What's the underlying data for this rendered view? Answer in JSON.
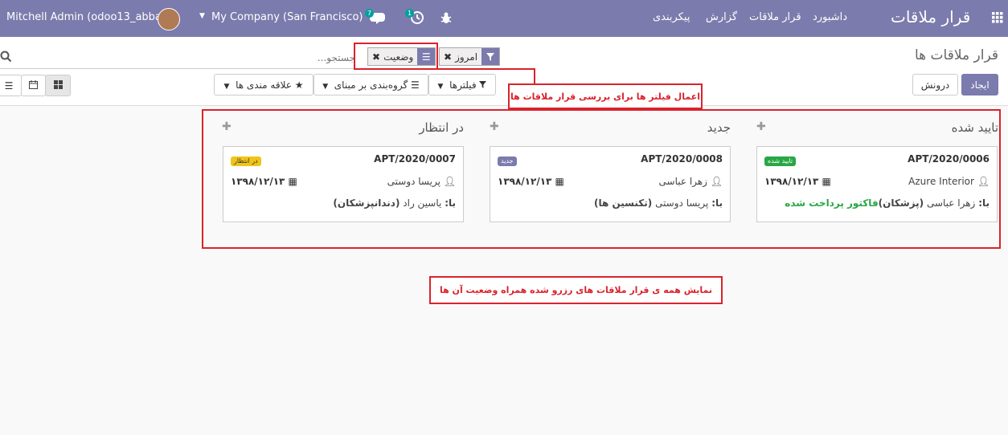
{
  "navbar": {
    "user_name": "Mitchell Admin (odoo13_abbasi)",
    "company": "My Company (San Francisco)",
    "messages_count": "7",
    "activities_count": "1",
    "app_title": "قرار ملاقات",
    "menu": [
      "داشبورد",
      "قرار ملاقات",
      "گزارش",
      "پیکربندی"
    ]
  },
  "control_panel": {
    "breadcrumb": "قرار ملاقات ها",
    "search_placeholder": "جستجو...",
    "facets": [
      {
        "label": "امروز",
        "icon": "filter-icon"
      },
      {
        "label": "وضعیت",
        "icon": "group-by-icon"
      }
    ],
    "create_label": "ایجاد",
    "import_label": "درونش",
    "filters_label": "فیلترها",
    "groupby_label": "گروه‌بندی بر مبنای",
    "favorites_label": "علاقه مندی ها"
  },
  "columns": [
    {
      "title": "تایید شده",
      "card": {
        "ref": "APT/2020/0006",
        "tag": "تایید شده",
        "tag_color": "#28a745",
        "user": "Azure Interior",
        "date": "۱۳۹۸/۱۲/۱۳",
        "with_label": "با:",
        "with_name": "زهرا عباسی",
        "with_specialty": "(پزشکان)",
        "extra": "فاکتور پرداخت شده",
        "extra_color": "#28a745"
      }
    },
    {
      "title": "جدید",
      "card": {
        "ref": "APT/2020/0008",
        "tag": "جدید",
        "tag_color": "#7c7bad",
        "user": "زهرا عباسی",
        "date": "۱۳۹۸/۱۲/۱۳",
        "with_label": "با:",
        "with_name": "پریسا دوستی",
        "with_specialty": "(تکنسین ها)"
      }
    },
    {
      "title": "در انتظار",
      "card": {
        "ref": "APT/2020/0007",
        "tag": "در انتظار",
        "tag_color": "#f0ad0e",
        "user": "پریسا دوستی",
        "date": "۱۳۹۸/۱۲/۱۳",
        "with_label": "با:",
        "with_name": "یاسین راد",
        "with_specialty": "(دندانپزشکان)"
      }
    }
  ],
  "annotations": {
    "filter_note": "اعمال فیلتر ها برای بررسی قرار ملاقات ها",
    "kanban_note": "نمایش همه ی قرار ملاقات های رزرو شده همراه وضعیت آن ها"
  },
  "colors": {
    "brand": "#7c7bad",
    "annotation": "#d9232d",
    "success": "#28a745",
    "warning": "#f0ad0e"
  }
}
